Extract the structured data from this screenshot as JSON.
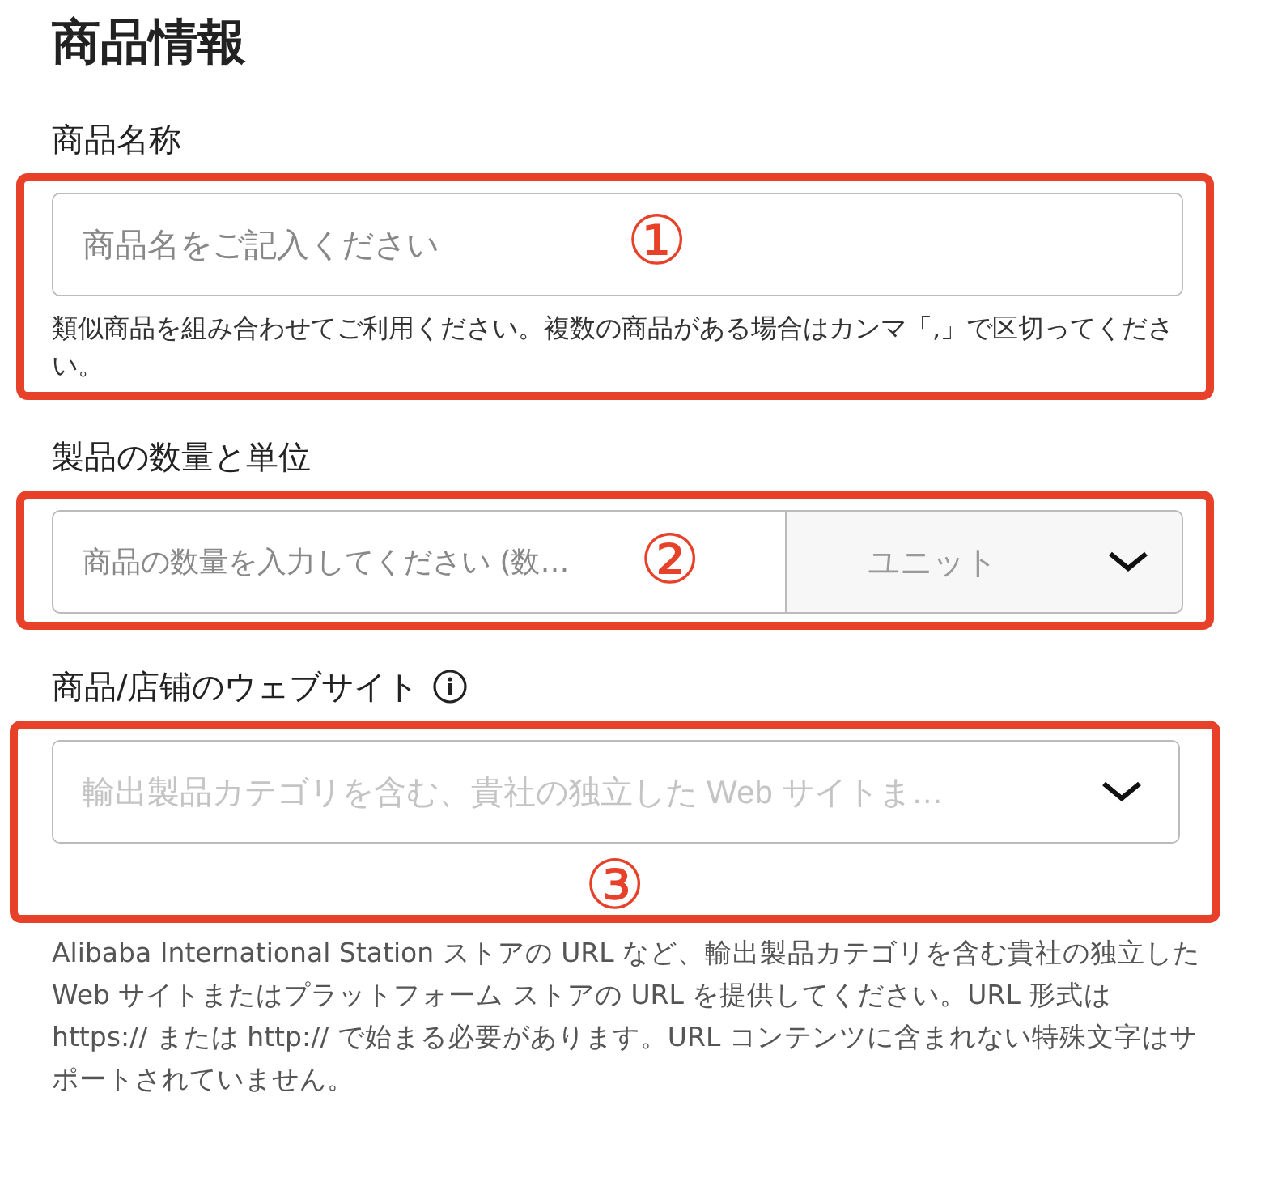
{
  "title": "商品情報",
  "sections": [
    {
      "kind": "text",
      "label": "商品名称",
      "placeholder": "商品名をご記入ください",
      "help": "類似商品を組み合わせてご利用ください。複数の商品がある場合はカンマ「,」で区切ってください。",
      "annotation": "①"
    },
    {
      "kind": "quantity",
      "label": "製品の数量と単位",
      "placeholder": "商品の数量を入力してください (数…",
      "unit_placeholder": "ユニット",
      "annotation": "②"
    },
    {
      "kind": "select",
      "label": "商品/店铺のウェブサイト",
      "has_info": true,
      "placeholder": "輸出製品カテゴリを含む、貴社の独立した Web サイトま…",
      "help": "Alibaba International Station ストアの URL など、輸出製品カテゴリを含む貴社の独立した Web サイトまたはプラットフォーム ストアの URL を提供してください。URL 形式は https:// または http:// で始まる必要があります。URL コンテンツに含まれない特殊文字はサポートされていません。",
      "annotation": "③"
    }
  ]
}
